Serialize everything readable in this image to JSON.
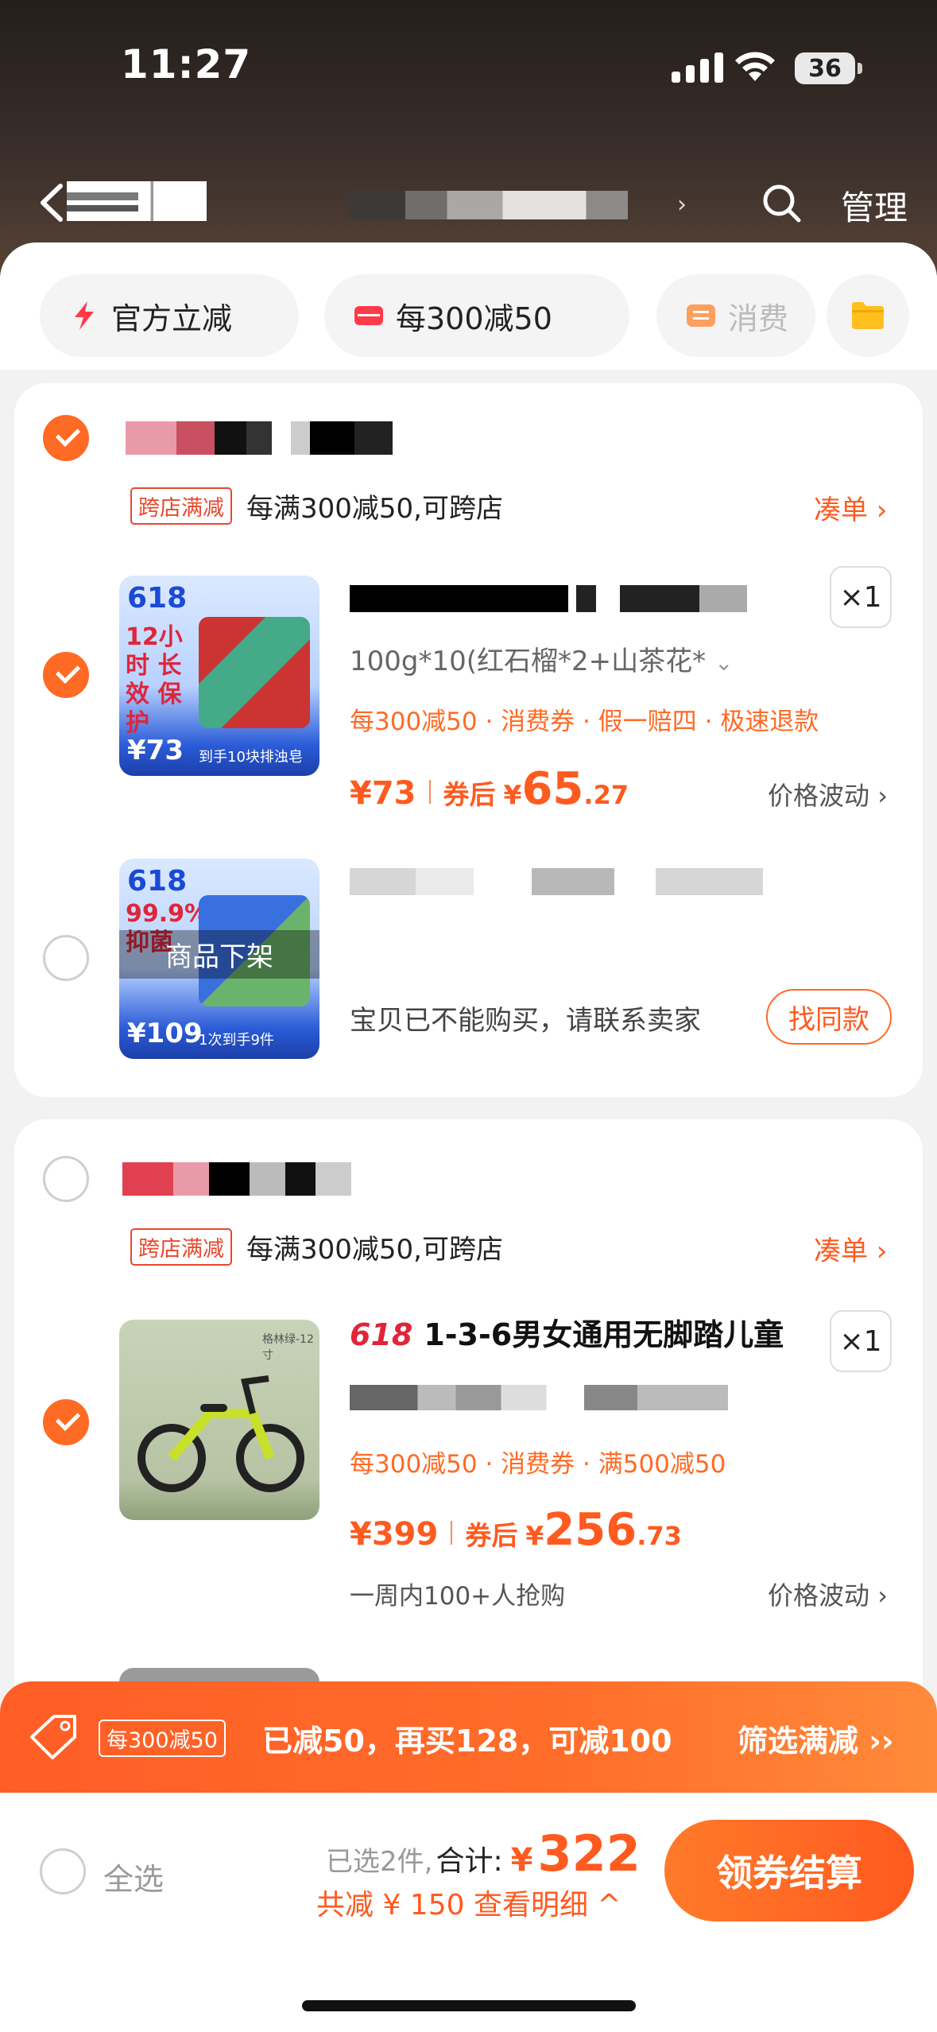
{
  "status_bar": {
    "time": "11:27",
    "battery": "36"
  },
  "nav": {
    "manage_label": "管理"
  },
  "chips": [
    {
      "label": "官方立减"
    },
    {
      "label": "每300减50"
    },
    {
      "label": "消费"
    }
  ],
  "groups": [
    {
      "promo_tag": "跨店满减",
      "promo_text": "每满300减50,可跨店",
      "coudan": "凑单",
      "items": [
        {
          "thumb_badge": "618",
          "thumb_headline": "12小时 长效 保护",
          "thumb_price": "73",
          "thumb_footer": "到手10块排浊皂",
          "spec": "100g*10(红石榴*2+山茶花*",
          "promos": "每300减50 · 消费券 · 假一赔四 · 极速退款",
          "price_prefix": "¥73",
          "coupon_label": "券后",
          "coupon_cur": "¥",
          "coupon_int": "65",
          "coupon_dec": ".27",
          "fluct": "价格波动",
          "qty": "×1"
        },
        {
          "thumb_badge": "618",
          "thumb_headline": "99.9% 抑菌",
          "thumb_price": "109",
          "thumb_footer": "1次到手9件",
          "overlay": "商品下架",
          "offline_text": "宝贝已不能购买，请联系卖家",
          "similar": "找同款"
        }
      ]
    },
    {
      "promo_tag": "跨店满减",
      "promo_text": "每满300减50,可跨店",
      "coudan": "凑单",
      "items": [
        {
          "title_prefix": "618",
          "title": "1-3-6男女通用无脚踏儿童",
          "thumb_caption": "格林绿-12寸",
          "promos": "每300减50 · 消费券 · 满500减50",
          "price_prefix": "¥399",
          "coupon_label": "券后",
          "coupon_cur": "¥",
          "coupon_int": "256",
          "coupon_dec": ".73",
          "grab": "一周内100+人抢购",
          "fluct": "价格波动",
          "qty": "×1"
        }
      ]
    }
  ],
  "banner": {
    "tag": "每300减50",
    "text": "已减50，再买128，可减100",
    "filter": "筛选满减 ››"
  },
  "footer": {
    "select_all": "全选",
    "selected": "已选2件,",
    "total_label": "合计:",
    "currency": "¥",
    "total": "322",
    "discount": "共减 ¥ 150  查看明细 ^",
    "checkout": "领券结算"
  }
}
